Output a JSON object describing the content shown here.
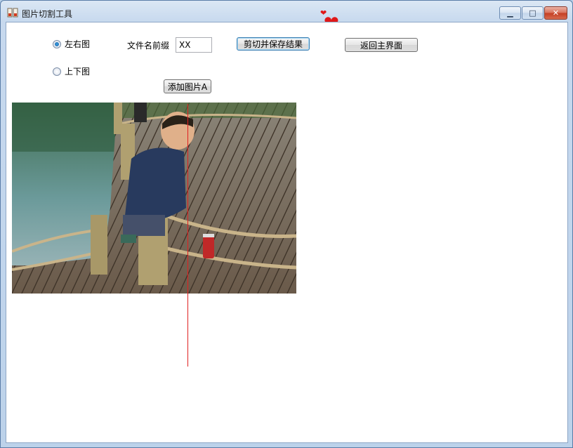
{
  "window": {
    "title": "图片切割工具",
    "minimize": "▁",
    "maximize": "□",
    "close": "✕"
  },
  "form": {
    "radio_lr_label": "左右图",
    "radio_tb_label": "上下图",
    "prefix_label": "文件名前缀",
    "prefix_value": "XX",
    "cut_save_button": "剪切并保存结果",
    "back_button": "返回主界面",
    "add_image_button": "添加图片A"
  },
  "colors": {
    "split_line": "#e02020",
    "heart": "#e01818"
  }
}
